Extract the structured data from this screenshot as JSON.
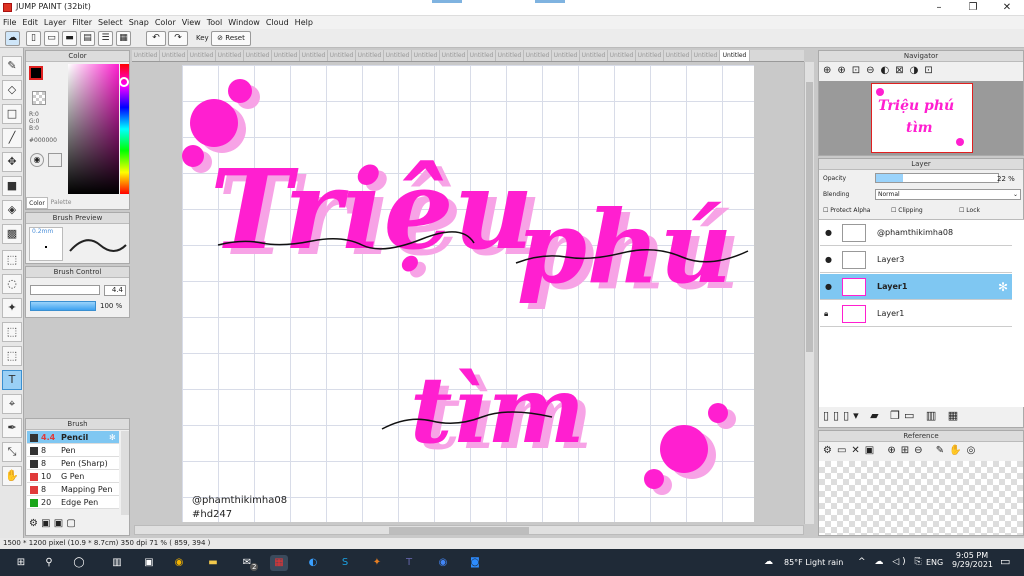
{
  "app": {
    "title": "JUMP PAINT (32bit)"
  },
  "menu": [
    "File",
    "Edit",
    "Layer",
    "Filter",
    "Select",
    "Snap",
    "Color",
    "View",
    "Tool",
    "Window",
    "Cloud",
    "Help"
  ],
  "toolbar": {
    "key_label": "Key",
    "reset_label": "Reset"
  },
  "color_panel": {
    "title": "Color",
    "r": "R:0",
    "g": "G:0",
    "b": "B:0",
    "hex": "#000000",
    "tab_color": "Color",
    "tab_palette": "Palette"
  },
  "brush_preview": {
    "title": "Brush Preview",
    "size": "0.2mm"
  },
  "brush_control": {
    "title": "Brush Control",
    "size": "4.4",
    "opacity": "100 %"
  },
  "brush_panel": {
    "title": "Brush",
    "items": [
      {
        "size": "4.4",
        "name": "Pencil",
        "color": "#333333"
      },
      {
        "size": "8",
        "name": "Pen",
        "color": "#333333"
      },
      {
        "size": "8",
        "name": "Pen (Sharp)",
        "color": "#333333"
      },
      {
        "size": "10",
        "name": "G Pen",
        "color": "#e03a3a"
      },
      {
        "size": "8",
        "name": "Mapping Pen",
        "color": "#e03a3a"
      },
      {
        "size": "20",
        "name": "Edge Pen",
        "color": "#1aa51a"
      }
    ]
  },
  "tabs": {
    "inactive_label": "Untitled",
    "active_label": "Untitled"
  },
  "canvas": {
    "line1a": "Triệu",
    "line1b": "phú",
    "line2": "tìm",
    "watermark1": "@phamthikimha08",
    "watermark2": "#hd247"
  },
  "navigator": {
    "title": "Navigator",
    "thumb_text1": "Triệu phú",
    "thumb_text2": "tìm"
  },
  "layer_panel": {
    "title": "Layer",
    "opacity_label": "Opacity",
    "opacity_value": "22 %",
    "opacity_fraction": 0.22,
    "blending_label": "Blending",
    "blending_value": "Normal",
    "protect_alpha": "Protect Alpha",
    "clipping": "Clipping",
    "lock": "Lock",
    "layers": [
      "@phamthikimha08",
      "Layer3",
      "Layer1",
      "Layer1"
    ]
  },
  "reference": {
    "title": "Reference"
  },
  "status": {
    "text": "1500 * 1200 pixel   (10.9 * 8.7cm)   350 dpi   71 %   ( 859, 394 )"
  },
  "taskbar": {
    "weather": "85°F  Light rain",
    "lang": "ENG",
    "time": "9:05 PM",
    "date": "9/29/2021",
    "mail_badge": "2"
  },
  "colors": {
    "accent_pink": "#ff1fd0",
    "shadow_pink": "#f7a3e6",
    "selection_blue": "#7fc7f2"
  }
}
